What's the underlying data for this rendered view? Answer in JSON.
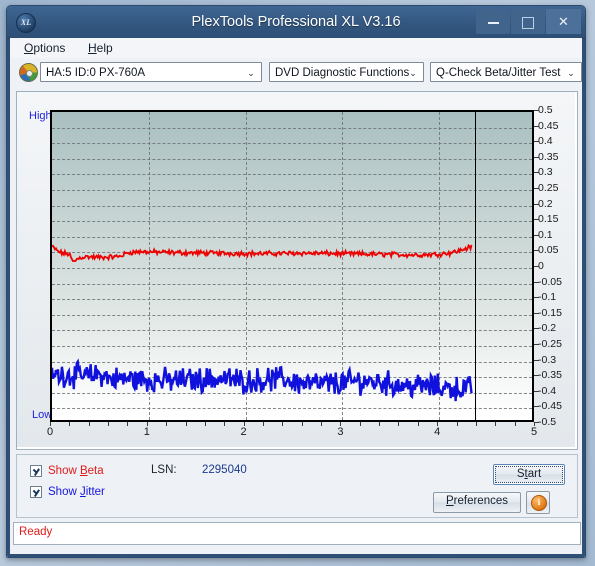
{
  "window": {
    "title": "PlexTools Professional XL V3.16",
    "logo_text": "XL",
    "minimize_label": "",
    "maximize_label": "",
    "close_label": "✕"
  },
  "menu": {
    "items": [
      {
        "label": "Options",
        "accel": "O"
      },
      {
        "label": "Help",
        "accel": "H"
      }
    ]
  },
  "toolbar": {
    "drive_icon": "disc-icon",
    "drive_select": {
      "value": "HA:5 ID:0  PX-760A",
      "arrow": "⌄"
    },
    "function_select": {
      "value": "DVD Diagnostic Functions",
      "arrow": "⌄"
    },
    "test_select": {
      "value": "Q-Check Beta/Jitter Test",
      "arrow": "⌄"
    }
  },
  "graph": {
    "high_label": "High",
    "low_label": "Low"
  },
  "controls": {
    "show_beta": {
      "label": "Show Beta",
      "accel": "B",
      "checked": true,
      "color": "#e01b1b"
    },
    "show_jitter": {
      "label": "Show Jitter",
      "accel": "J",
      "checked": true,
      "color": "#1515dd"
    },
    "lsn_label": "LSN:",
    "lsn_value": "2295040",
    "start_button": "Start",
    "start_accel": "S",
    "preferences_button": "Preferences",
    "preferences_accel": "P",
    "info_button": "i"
  },
  "status": {
    "text": "Ready"
  },
  "chart_data": {
    "type": "line",
    "title": "Q-Check Beta/Jitter Test",
    "xlabel": "",
    "ylabel": "",
    "xlim": [
      0,
      5
    ],
    "ylim": [
      -0.5,
      0.5
    ],
    "xticks": [
      0,
      1,
      2,
      3,
      4,
      5
    ],
    "yticks": [
      0.5,
      0.45,
      0.4,
      0.35,
      0.3,
      0.25,
      0.2,
      0.15,
      0.1,
      0.05,
      0,
      -0.05,
      -0.1,
      -0.15,
      -0.2,
      -0.25,
      -0.3,
      -0.35,
      -0.4,
      -0.45,
      -0.5
    ],
    "ytick_labels": [
      "0.5",
      "0.45",
      "0.4",
      "0.35",
      "0.3",
      "0.25",
      "0.2",
      "0.15",
      "0.1",
      "0.05",
      "0",
      "-0.05",
      "-0.1",
      "-0.15",
      "-0.2",
      "-0.25",
      "-0.3",
      "-0.35",
      "-0.4",
      "-0.45",
      "-0.5"
    ],
    "grid": true,
    "data_end_x": 4.37,
    "legend": [
      "Show Beta",
      "Show Jitter"
    ],
    "series": [
      {
        "name": "Beta",
        "color": "#ee0000",
        "noise": 0.006,
        "x": [
          0.0,
          0.05,
          0.1,
          0.14,
          0.18,
          0.22,
          0.26,
          0.3,
          0.36,
          0.42,
          0.5,
          0.6,
          0.7,
          0.8,
          0.9,
          1.0,
          1.2,
          1.4,
          1.6,
          1.8,
          2.0,
          2.2,
          2.4,
          2.6,
          2.8,
          3.0,
          3.2,
          3.4,
          3.6,
          3.8,
          4.0,
          4.15,
          4.25,
          4.32,
          4.37
        ],
        "y": [
          0.063,
          0.05,
          0.042,
          0.04,
          0.039,
          0.012,
          0.022,
          0.028,
          0.03,
          0.029,
          0.028,
          0.029,
          0.031,
          0.044,
          0.046,
          0.046,
          0.044,
          0.043,
          0.042,
          0.041,
          0.041,
          0.04,
          0.041,
          0.042,
          0.041,
          0.04,
          0.039,
          0.038,
          0.037,
          0.036,
          0.038,
          0.043,
          0.05,
          0.058,
          0.062
        ]
      },
      {
        "name": "Jitter",
        "color": "#1111dd",
        "noise": 0.03,
        "x": [
          0.0,
          0.1,
          0.2,
          0.3,
          0.4,
          0.5,
          0.6,
          0.7,
          0.8,
          0.9,
          1.0,
          1.2,
          1.4,
          1.6,
          1.8,
          2.0,
          2.2,
          2.4,
          2.6,
          2.8,
          3.0,
          3.2,
          3.4,
          3.6,
          3.8,
          4.0,
          4.15,
          4.25,
          4.32,
          4.37
        ],
        "y": [
          -0.356,
          -0.352,
          -0.354,
          -0.356,
          -0.358,
          -0.35,
          -0.366,
          -0.368,
          -0.366,
          -0.368,
          -0.37,
          -0.372,
          -0.37,
          -0.368,
          -0.366,
          -0.374,
          -0.37,
          -0.366,
          -0.38,
          -0.384,
          -0.38,
          -0.374,
          -0.376,
          -0.386,
          -0.39,
          -0.392,
          -0.396,
          -0.398,
          -0.398,
          -0.398
        ]
      }
    ]
  }
}
